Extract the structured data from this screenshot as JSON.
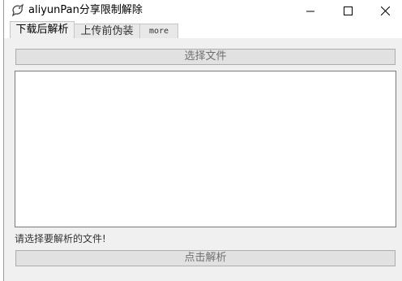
{
  "window": {
    "title": "aliyunPan分享限制解除",
    "app_icon": "bird-icon",
    "controls": [
      "minimize-icon",
      "maximize-icon",
      "close-icon"
    ]
  },
  "tabs": [
    {
      "label": "下载后解析",
      "active": true
    },
    {
      "label": "上传前伪装",
      "active": false
    },
    {
      "label": "more",
      "active": false
    }
  ],
  "main": {
    "select_button_label": "选择文件",
    "output_text": "",
    "status_text": "请选择要解析的文件!",
    "parse_button_label": "点击解析"
  }
}
